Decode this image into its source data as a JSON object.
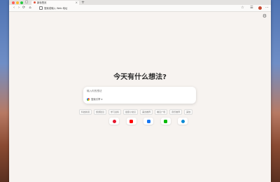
{
  "browser": {
    "tab": {
      "title": "新标签页",
      "close": "×"
    },
    "new_tab": "+",
    "address": "搜索或输入 Web 地址",
    "nav": {
      "back": "‹",
      "forward": "›",
      "reload": "⟳",
      "home": "⌂"
    },
    "toolbar_icons": [
      "☆",
      "☰",
      "⋯"
    ]
  },
  "page": {
    "settings_icon": "⚙",
    "heading": "今天有什么想法?",
    "search": {
      "placeholder": "输入你的想法",
      "engine": "搜索引擎 ▾"
    },
    "chips": [
      "科技新闻",
      "旅游建议",
      "学习资料",
      "健康小常识",
      "美食推荐",
      "看见广场",
      "音乐推荐",
      "其他"
    ],
    "shortcuts": [
      {
        "name": "weibo",
        "color": "#e6162d"
      },
      {
        "name": "youtube",
        "color": "#ff0000"
      },
      {
        "name": "facebook",
        "color": "#1877f2"
      },
      {
        "name": "wechat",
        "color": "#09bb07"
      },
      {
        "name": "edge",
        "color": "#0c8ad4"
      }
    ]
  },
  "colors": {
    "page_bg": "#f7f3f0",
    "accent": "#e0533a"
  }
}
